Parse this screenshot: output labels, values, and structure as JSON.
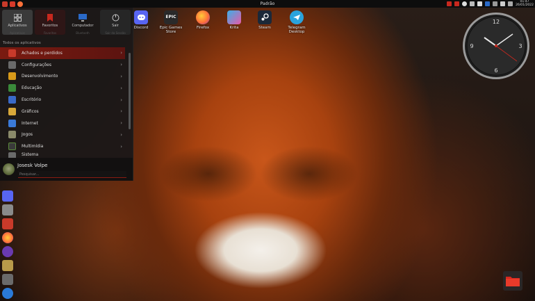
{
  "window_title": "Padrão",
  "clock": {
    "time": "01:47",
    "date": "26/01/2022"
  },
  "desktop_icons": [
    {
      "label": "Discord",
      "icon": "discord-icon",
      "color": "#5865f2"
    },
    {
      "label": "Epic Games Store",
      "icon": "epic-games-icon",
      "color": "#2a2a2a"
    },
    {
      "label": "Firefox",
      "icon": "firefox-icon",
      "color": "#ff7139"
    },
    {
      "label": "Krita",
      "icon": "krita-icon",
      "color": "#e85aa8"
    },
    {
      "label": "Steam",
      "icon": "steam-icon",
      "color": "#1b2838"
    },
    {
      "label": "Telegram Desktop",
      "icon": "telegram-icon",
      "color": "#2aa3dd"
    }
  ],
  "menu": {
    "tabs": [
      {
        "label": "Aplicativos",
        "ghost": "Aplicativos",
        "icon": "grid-icon"
      },
      {
        "label": "Favoritos",
        "ghost": "Favoritos",
        "icon": "bookmark-icon"
      },
      {
        "label": "Computador",
        "ghost": "Bluetooth",
        "icon": "monitor-icon"
      },
      {
        "label": "Sair",
        "ghost": "Sair da Sessão",
        "icon": "power-icon"
      }
    ],
    "section_title": "Todos os aplicativos",
    "categories": [
      {
        "label": "Achados e perdidos",
        "color": "#c83a2a"
      },
      {
        "label": "Configurações",
        "color": "#6a6a6a"
      },
      {
        "label": "Desenvolvimento",
        "color": "#d89a1a"
      },
      {
        "label": "Educação",
        "color": "#3a8a3a"
      },
      {
        "label": "Escritório",
        "color": "#3a6ac8"
      },
      {
        "label": "Gráficos",
        "color": "#d8a83a"
      },
      {
        "label": "Internet",
        "color": "#3a7ad8"
      },
      {
        "label": "Jogos",
        "color": "#8a8a6a"
      },
      {
        "label": "Multimídia",
        "color": "#3a3a3a"
      },
      {
        "label": "Sistema",
        "color": "#6a6a6a"
      }
    ],
    "user_name": "Josesk Volpe",
    "search_placeholder": "Pesquisar..."
  },
  "dock_icons": [
    {
      "icon": "discord-icon",
      "color": "#5865f2"
    },
    {
      "icon": "calculator-icon",
      "color": "#8a8a8a"
    },
    {
      "icon": "app-store-icon",
      "color": "#c83a2a"
    },
    {
      "icon": "firefox-icon",
      "color": "#ff7139"
    },
    {
      "icon": "github-icon",
      "color": "#6a3ab0"
    },
    {
      "icon": "archive-icon",
      "color": "#b89a4a"
    },
    {
      "icon": "settings-icon",
      "color": "#6a6a6a"
    },
    {
      "icon": "steam-icon",
      "color": "#2a7ad8"
    }
  ]
}
